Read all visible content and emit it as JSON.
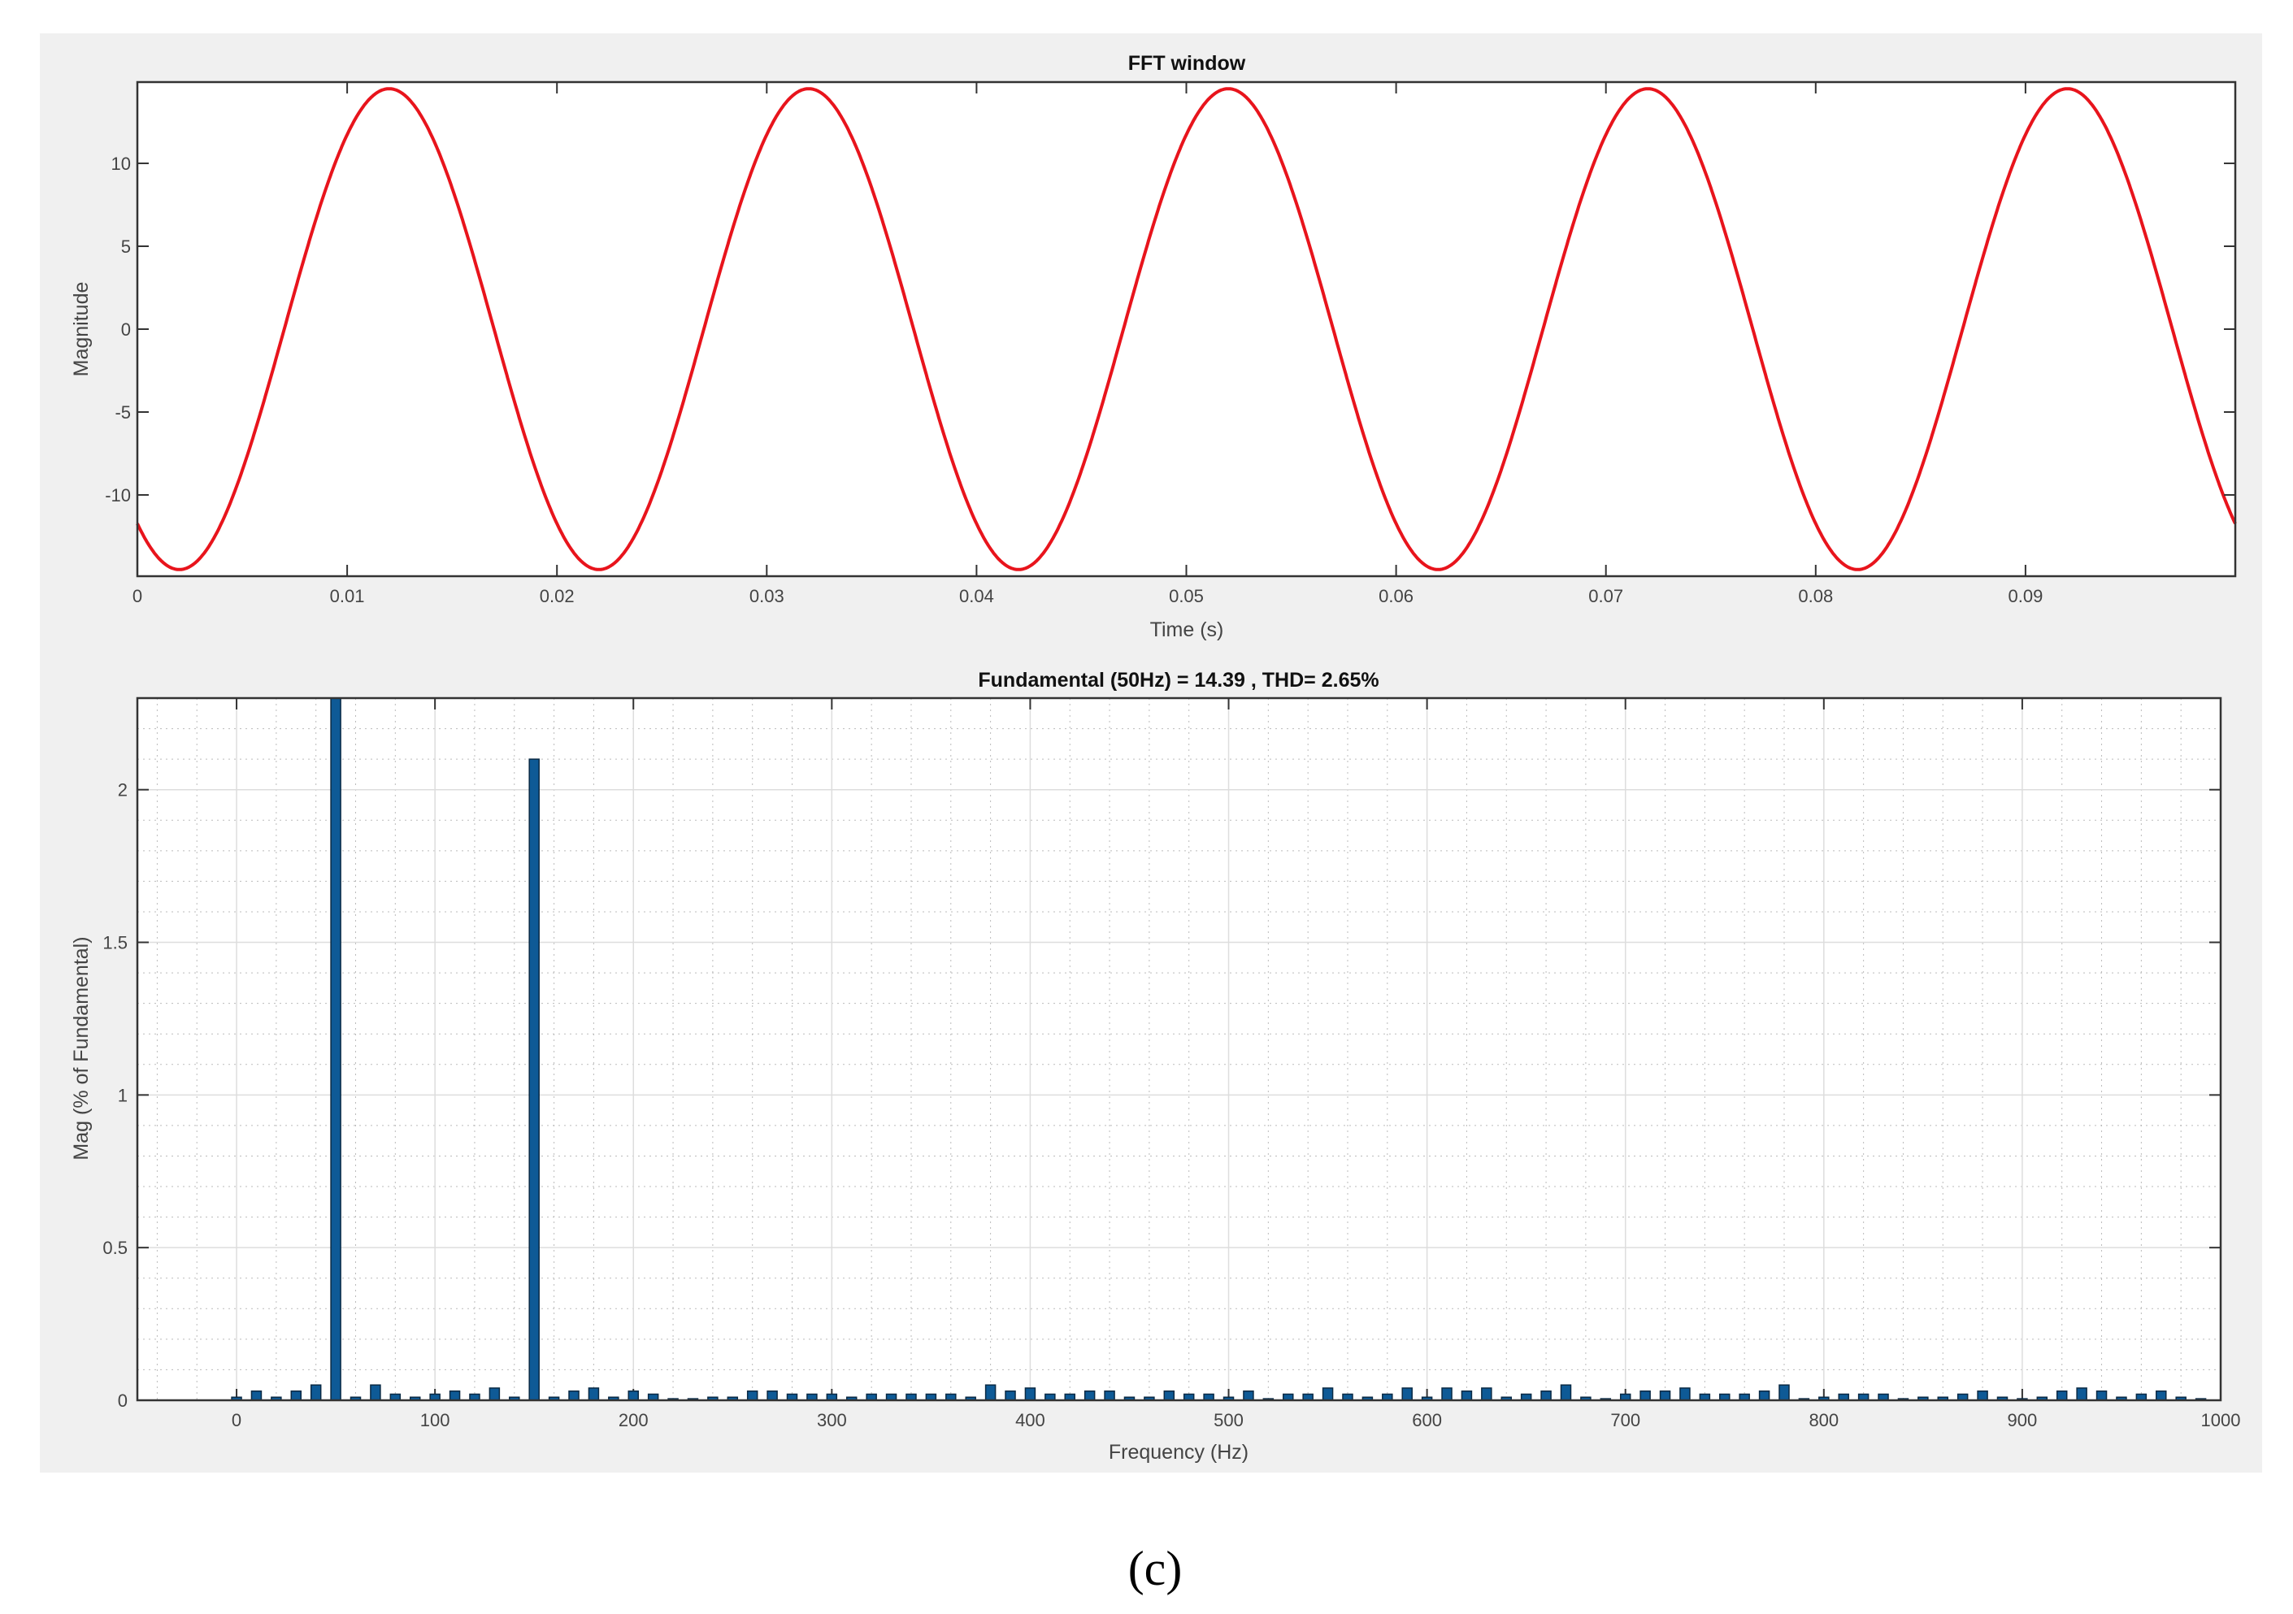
{
  "caption": "(c)",
  "chart_data": [
    {
      "type": "line",
      "title": "FFT window",
      "xlabel": "Time (s)",
      "ylabel": "Magnitude",
      "xlim": [
        0,
        0.1
      ],
      "ylim": [
        -14.9,
        14.9
      ],
      "xticks": [
        "0",
        "0.01",
        "0.02",
        "0.03",
        "0.04",
        "0.05",
        "0.06",
        "0.07",
        "0.08",
        "0.09"
      ],
      "xtick_values": [
        0,
        0.01,
        0.02,
        0.03,
        0.04,
        0.05,
        0.06,
        0.07,
        0.08,
        0.09
      ],
      "yticks": [
        "10",
        "5",
        "0",
        "-5",
        "-10"
      ],
      "ytick_values": [
        10,
        5,
        0,
        -5,
        -10
      ],
      "series": [
        {
          "name": "signal",
          "color": "#e8141c",
          "function": "sinusoid",
          "amplitude": 14.5,
          "frequency_hz": 50,
          "first_minimum_s": 0.002
        }
      ],
      "grid": false
    },
    {
      "type": "bar",
      "title": "Fundamental (50Hz) = 14.39 , THD= 2.65%",
      "xlabel": "Frequency (Hz)",
      "ylabel": "Mag (% of Fundamental)",
      "xlim": [
        -50,
        1000
      ],
      "ylim": [
        0,
        2.3
      ],
      "xticks": [
        "0",
        "100",
        "200",
        "300",
        "400",
        "500",
        "600",
        "700",
        "800",
        "900",
        "1000"
      ],
      "xtick_values": [
        0,
        100,
        200,
        300,
        400,
        500,
        600,
        700,
        800,
        900,
        1000
      ],
      "yticks": [
        "0",
        "0.5",
        "1",
        "1.5",
        "2"
      ],
      "ytick_values": [
        0,
        0.5,
        1,
        1.5,
        2
      ],
      "bar_color": "#0e5a96",
      "grid": true,
      "x_start": 0,
      "x_step": 10,
      "values": [
        0.01,
        0.03,
        0.01,
        0.03,
        0.05,
        100,
        0.01,
        0.05,
        0.02,
        0.01,
        0.02,
        0.03,
        0.02,
        0.04,
        0.01,
        2.1,
        0.01,
        0.03,
        0.04,
        0.01,
        0.03,
        0.02,
        0.005,
        0.005,
        0.01,
        0.01,
        0.03,
        0.03,
        0.02,
        0.02,
        0.02,
        0.01,
        0.02,
        0.02,
        0.02,
        0.02,
        0.02,
        0.01,
        0.05,
        0.03,
        0.04,
        0.02,
        0.02,
        0.03,
        0.03,
        0.01,
        0.01,
        0.03,
        0.02,
        0.02,
        0.01,
        0.03,
        0.005,
        0.02,
        0.02,
        0.04,
        0.02,
        0.01,
        0.02,
        0.04,
        0.01,
        0.04,
        0.03,
        0.04,
        0.01,
        0.02,
        0.03,
        0.05,
        0.01,
        0.005,
        0.02,
        0.03,
        0.03,
        0.04,
        0.02,
        0.02,
        0.02,
        0.03,
        0.05,
        0.005,
        0.01,
        0.02,
        0.02,
        0.02,
        0.005,
        0.01,
        0.01,
        0.02,
        0.03,
        0.01,
        0.005,
        0.01,
        0.03,
        0.04,
        0.03,
        0.01,
        0.02,
        0.03,
        0.01,
        0.005
      ]
    }
  ]
}
